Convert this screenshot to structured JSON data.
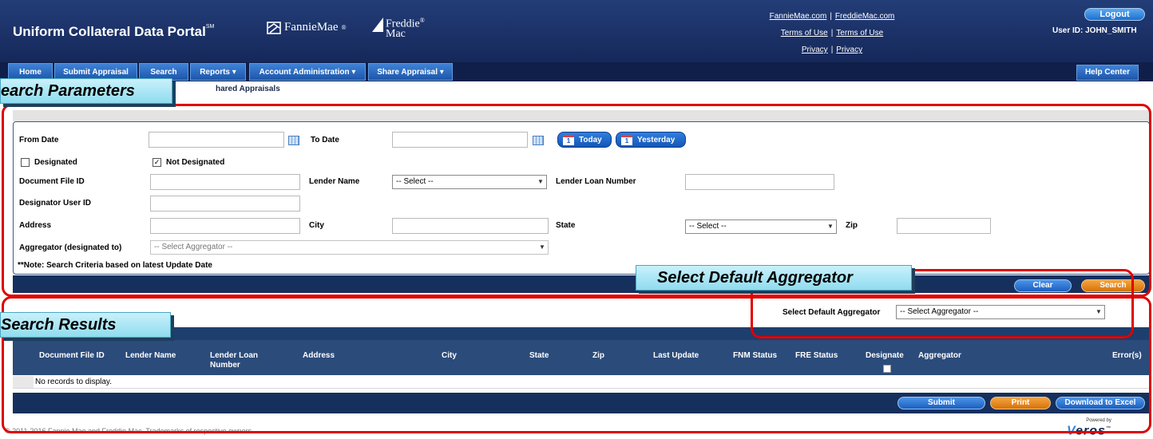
{
  "header": {
    "portal_title": "Uniform Collateral Data Portal",
    "portal_title_mark": "SM",
    "logo_fannie": "FannieMae",
    "logo_fannie_mark": "®",
    "logo_freddie_line1": "Freddie",
    "logo_freddie_line2": "Mac",
    "logo_freddie_mark": "®",
    "links": {
      "fanniemae": "FannieMae.com",
      "freddiemac": "FreddieMac.com",
      "terms1": "Terms of Use",
      "terms2": "Terms of Use",
      "privacy1": "Privacy",
      "privacy2": "Privacy",
      "separator": "|"
    },
    "logout_label": "Logout",
    "user_id": "User ID: JOHN_SMITH"
  },
  "nav": {
    "items": [
      {
        "label": "Home"
      },
      {
        "label": "Submit Appraisal"
      },
      {
        "label": "Search"
      },
      {
        "label": "Reports"
      },
      {
        "label": "Account Administration"
      },
      {
        "label": "Share Appraisal"
      }
    ],
    "help_label": "Help Center"
  },
  "breadcrumb": "hared Appraisals",
  "search_form": {
    "from_date_label": "From Date",
    "from_date_value": "",
    "to_date_label": "To Date",
    "to_date_value": "",
    "today_label": "Today",
    "yesterday_label": "Yesterday",
    "calendar_day": "1",
    "designated_label": "Designated",
    "designated_checked": false,
    "not_designated_label": "Not Designated",
    "not_designated_checked": true,
    "check_mark": "✓",
    "document_file_id_label": "Document File ID",
    "lender_name_label": "Lender Name",
    "lender_name_value": "-- Select --",
    "lender_loan_number_label": "Lender Loan Number",
    "designator_user_id_label": "Designator User ID",
    "address_label": "Address",
    "city_label": "City",
    "state_label": "State",
    "state_value": "-- Select --",
    "zip_label": "Zip",
    "aggregator_label": "Aggregator (designated to)",
    "aggregator_placeholder": "-- Select Aggregator --",
    "note": "**Note: Search Criteria based on latest Update Date",
    "clear_label": "Clear",
    "search_label": "Search"
  },
  "results": {
    "default_aggregator_label": "Select Default Aggregator",
    "default_aggregator_value": "-- Select Aggregator --",
    "columns": {
      "document_file_id": "Document File ID",
      "lender_name": "Lender Name",
      "lender_loan_number_l1": "Lender Loan",
      "lender_loan_number_l2": "Number",
      "address": "Address",
      "city": "City",
      "state": "State",
      "zip": "Zip",
      "last_update": "Last Update",
      "fnm_status": "FNM Status",
      "fre_status": "FRE Status",
      "designate": "Designate",
      "aggregator": "Aggregator",
      "errors": "Error(s)"
    },
    "empty_message": "No records to display.",
    "submit_label": "Submit",
    "print_label": "Print",
    "download_label": "Download to Excel"
  },
  "footer": {
    "copyright": "© 2011-2016 Fannie Mae and Freddie Mac. Trademarks of respective owners.",
    "powered_by": "Powered by",
    "brand_v": "V",
    "brand_rest": "eros",
    "brand_mark": "™"
  },
  "annotations": {
    "search_parameters": "earch Parameters",
    "select_default_aggregator": "Select Default Aggregator",
    "search_results": "Search Results"
  },
  "colors": {
    "header_navy": "#1b2f66",
    "annotation_red": "#e00000",
    "callout_cyan": "#a7e6f5",
    "button_blue": "#1c5fc0",
    "button_orange": "#e8870f"
  }
}
